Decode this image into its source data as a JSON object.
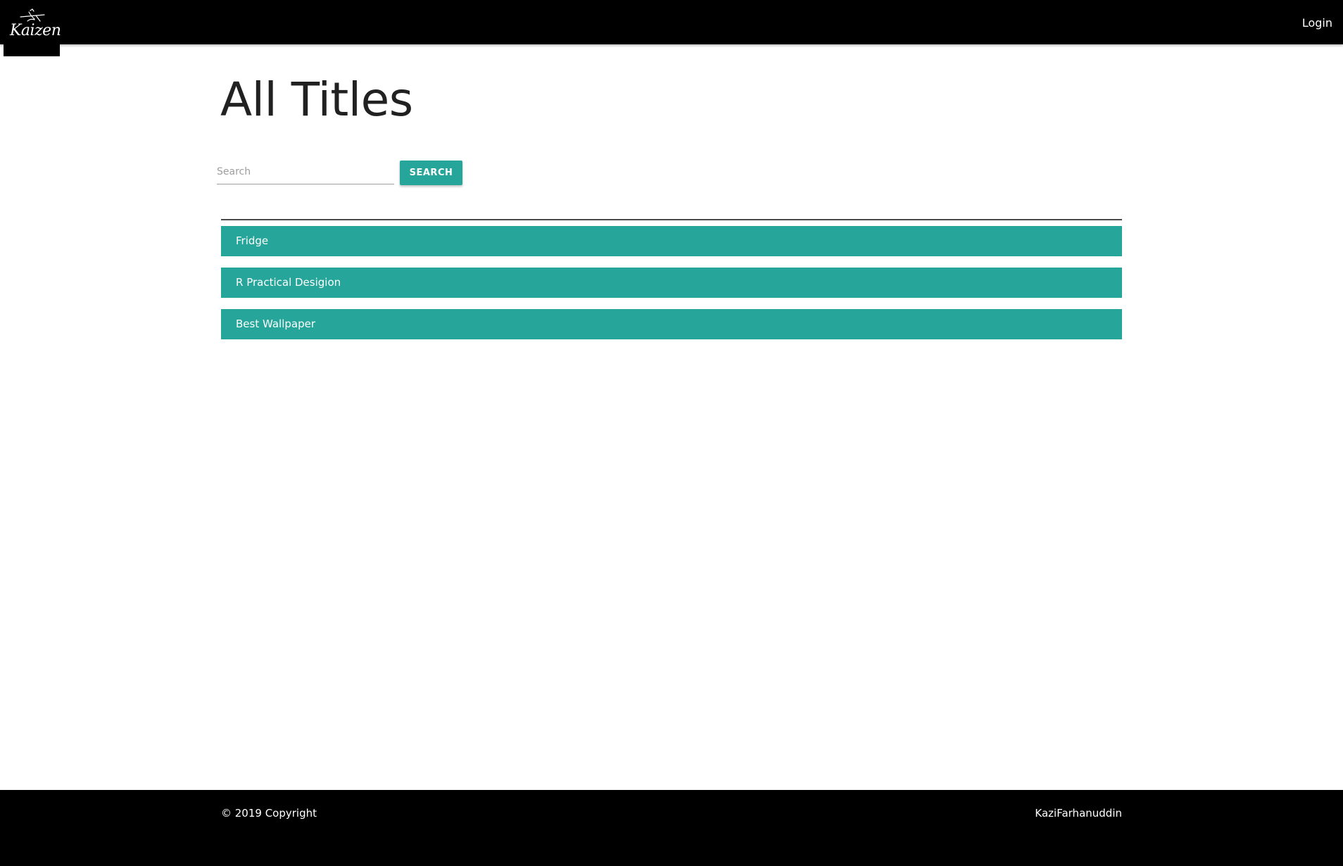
{
  "navbar": {
    "logo_text": "Kaizen",
    "login_label": "Login"
  },
  "main": {
    "page_title": "All Titles",
    "search": {
      "placeholder": "Search",
      "value": "",
      "button_label": "SEARCH"
    },
    "titles": [
      "Fridge",
      "R Practical Desigion",
      "Best Wallpaper"
    ]
  },
  "footer": {
    "copyright": "© 2019 Copyright",
    "author": "KaziFarhanuddin"
  },
  "colors": {
    "navbar_bg": "#000000",
    "accent": "#26a69a",
    "title_text": "#212121",
    "footer_bg": "#000000"
  },
  "icons": {
    "logo": "kaizen-logo-icon"
  }
}
